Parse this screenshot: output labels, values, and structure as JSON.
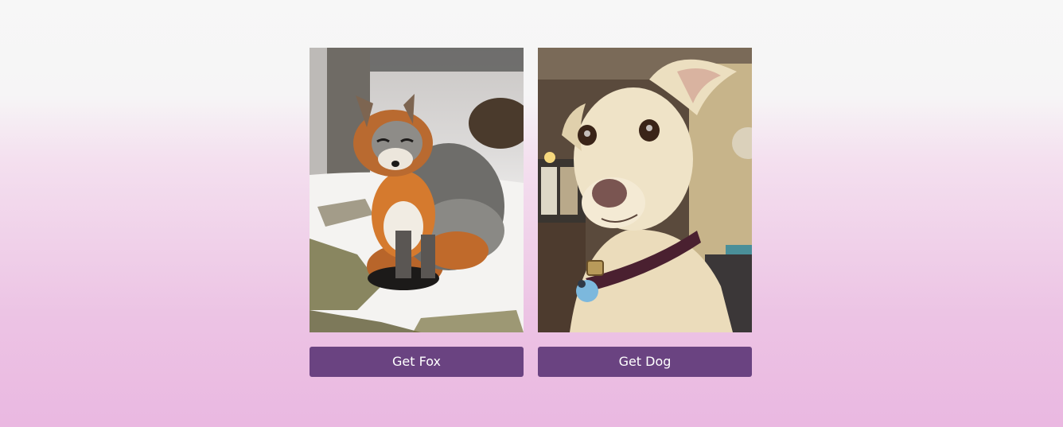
{
  "cards": [
    {
      "photo_subject": "fox-photo",
      "button_label": "Get Fox"
    },
    {
      "photo_subject": "dog-photo",
      "button_label": "Get Dog"
    }
  ],
  "colors": {
    "button_bg": "#6a4381",
    "button_text": "#ffffff",
    "background_top": "#f7f7f7",
    "background_bottom": "#eab8e1"
  }
}
